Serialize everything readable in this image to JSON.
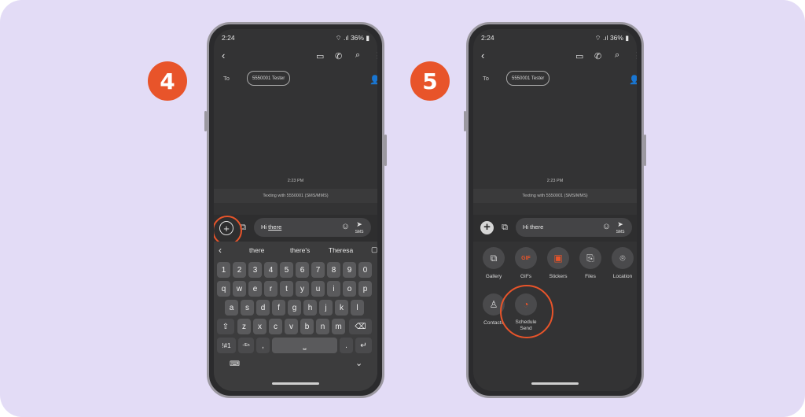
{
  "steps": {
    "left": "4",
    "right": "5"
  },
  "status": {
    "time": "2:24",
    "battery": "36%"
  },
  "to_label": "To",
  "recipient": "5550001 Tester",
  "message_time": "2:23 PM",
  "texting_with": "Texting with 5550001 (SMS/MMS)",
  "input": {
    "prefix": "Hi ",
    "underlined": "there",
    "full": "Hi there"
  },
  "send_label": "SMS",
  "suggestions": [
    "there",
    "there's",
    "Theresa"
  ],
  "keyboard": {
    "row_numbers": [
      "1",
      "2",
      "3",
      "4",
      "5",
      "6",
      "7",
      "8",
      "9",
      "0"
    ],
    "row_top": [
      "q",
      "w",
      "e",
      "r",
      "t",
      "y",
      "u",
      "i",
      "o",
      "p"
    ],
    "row_mid": [
      "a",
      "s",
      "d",
      "f",
      "g",
      "h",
      "j",
      "k",
      "l"
    ],
    "row_bot": [
      "z",
      "x",
      "c",
      "v",
      "b",
      "n",
      "m"
    ],
    "sym": "!#1",
    "lang": "-/En",
    "comma": ",",
    "period": "."
  },
  "attachments": [
    {
      "label": "Gallery",
      "icon": "gallery-icon"
    },
    {
      "label": "GIFs",
      "icon": "gif-icon"
    },
    {
      "label": "Stickers",
      "icon": "sticker-icon"
    },
    {
      "label": "Files",
      "icon": "paperclip-icon"
    },
    {
      "label": "Location",
      "icon": "location-pin-icon"
    },
    {
      "label": "Contacts",
      "icon": "contact-icon"
    },
    {
      "label": "Schedule Send",
      "icon": "clock-icon"
    }
  ],
  "colors": {
    "accent": "#e8542a",
    "background": "#e3dcf6",
    "screen": "#333334"
  }
}
